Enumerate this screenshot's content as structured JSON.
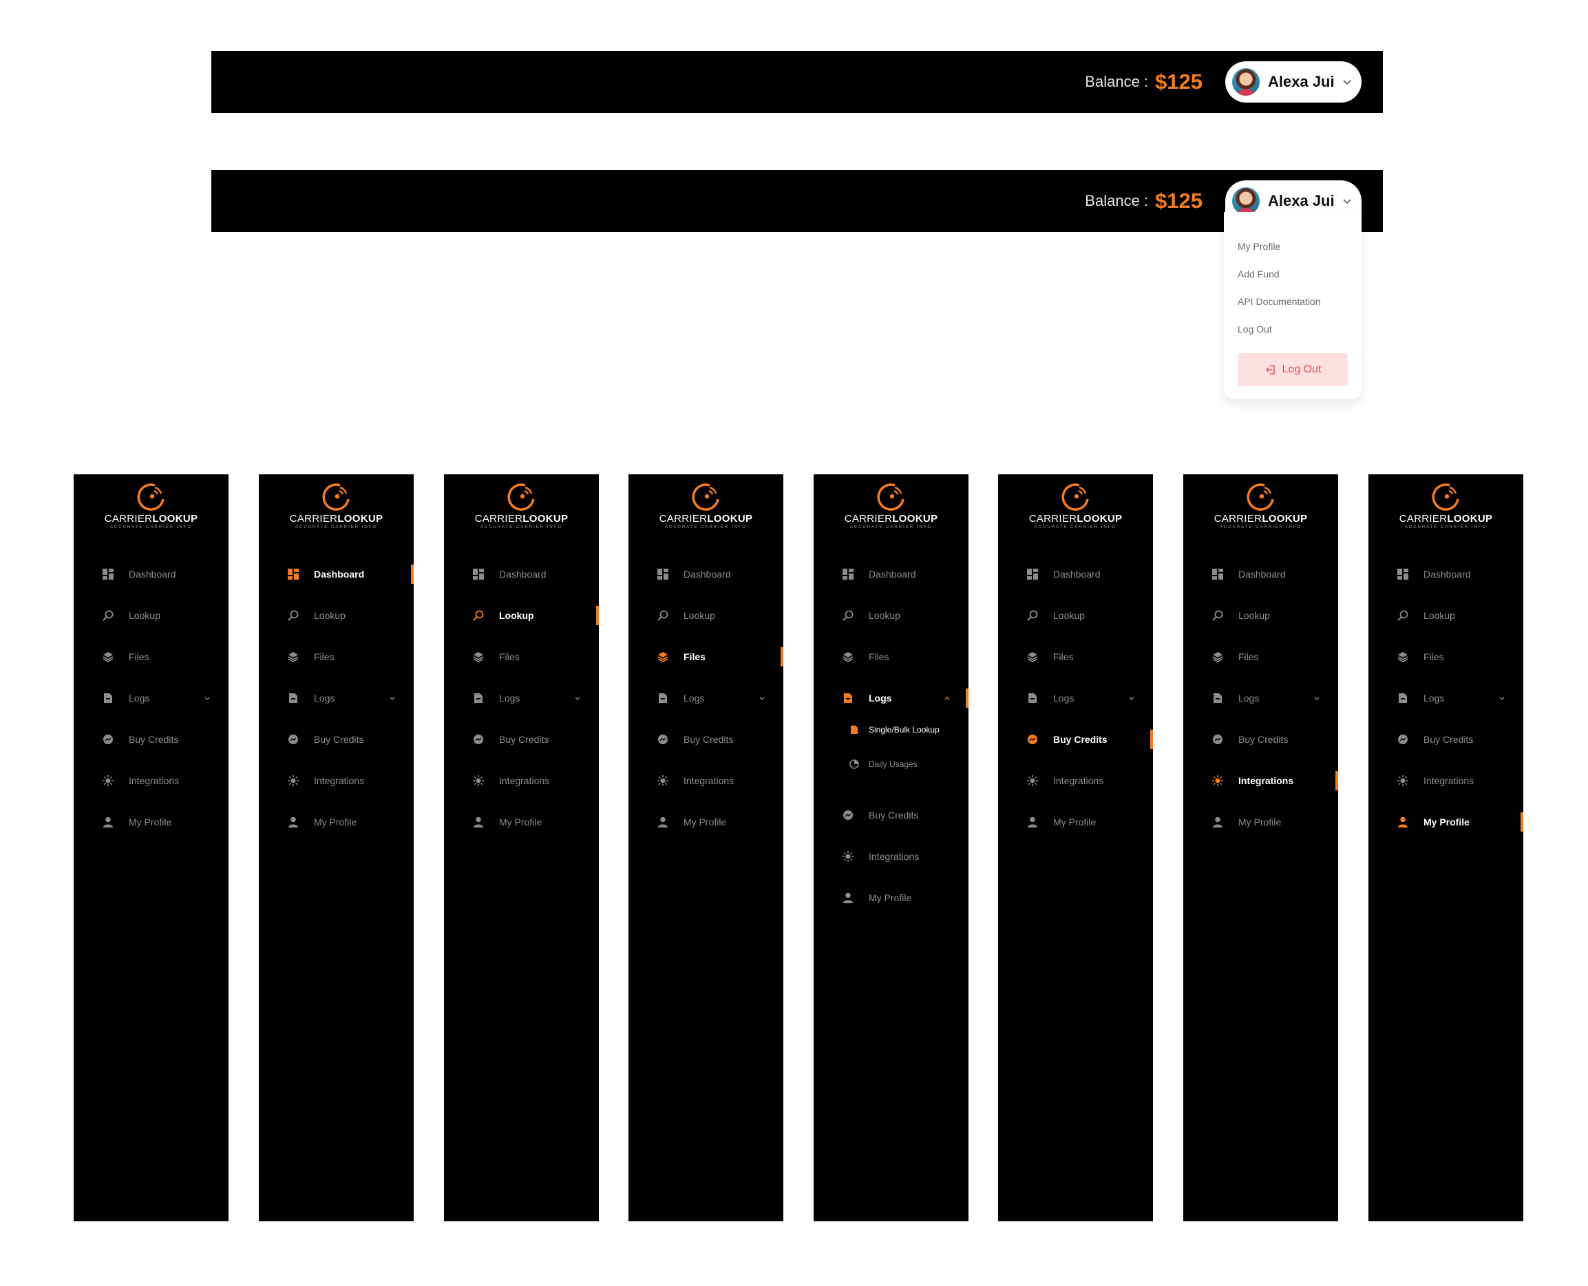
{
  "topbar": {
    "balance_label": "Balance :",
    "balance_value": "$125",
    "user_name": "Alexa Jui"
  },
  "dropdown": {
    "items": [
      "My Profile",
      "Add Fund",
      "API Documentation",
      "Log Out"
    ],
    "logout_button": "Log Out"
  },
  "brand": {
    "name_light": "CARRIER",
    "name_bold": "LOOKUP",
    "tagline": "ACCURATE CARRIER INFO"
  },
  "nav": {
    "dashboard": "Dashboard",
    "lookup": "Lookup",
    "files": "Files",
    "logs": "Logs",
    "buy_credits": "Buy Credits",
    "integrations": "Integrations",
    "my_profile": "My Profile",
    "logs_sub": [
      "Single/Bulk Lookup",
      "Daily Usages"
    ]
  },
  "sidebar_states": [
    {
      "active": "none"
    },
    {
      "active": "dashboard"
    },
    {
      "active": "lookup"
    },
    {
      "active": "files"
    },
    {
      "active": "logs",
      "expanded": true
    },
    {
      "active": "buy_credits"
    },
    {
      "active": "integrations"
    },
    {
      "active": "my_profile"
    }
  ],
  "colors": {
    "accent": "#f57c1f",
    "sidebar_bg": "#000000",
    "inactive_text": "#8c8c8c",
    "logout_bg": "#fde1e1",
    "logout_text": "#ef4c4c"
  }
}
